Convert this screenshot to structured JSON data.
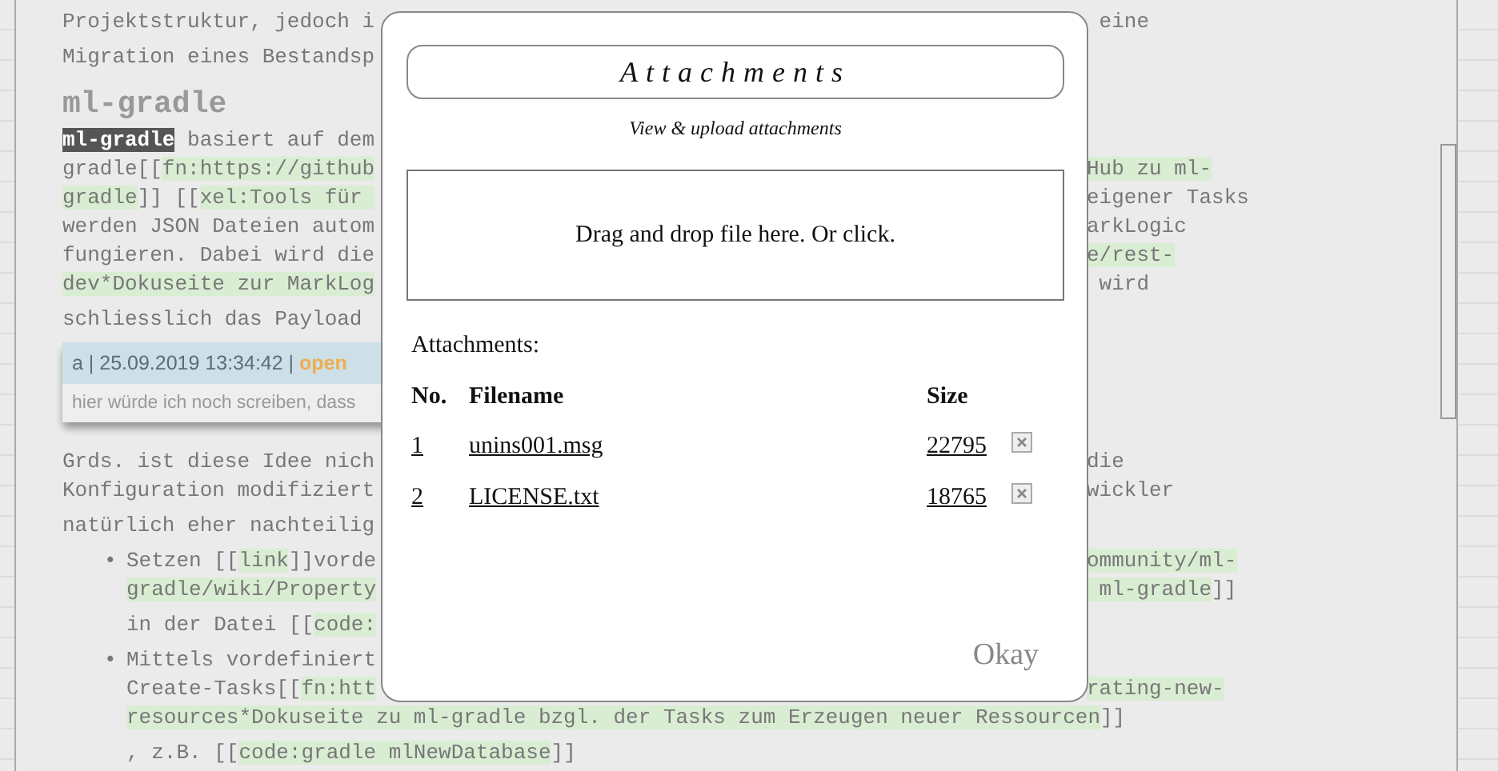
{
  "document": {
    "blocks": [
      {
        "kind": "paragraph",
        "lines": [
          {
            "left": [
              {
                "kind": "plain",
                "text": "Projektstruktur, jedoch i"
              }
            ],
            "right": [
              {
                "kind": "plain",
                "text": " eine"
              }
            ]
          },
          {
            "left": [
              {
                "kind": "plain",
                "text": "Migration eines Bestandsp"
              }
            ]
          }
        ]
      },
      {
        "kind": "heading",
        "text": "ml-gradle"
      },
      {
        "kind": "paragraph",
        "lines": [
          {
            "left": [
              {
                "kind": "dark",
                "text": "ml-gradle"
              },
              {
                "kind": "plain",
                "text": " basiert auf dem"
              }
            ]
          },
          {
            "left": [
              {
                "kind": "plain",
                "text": "gradle[["
              },
              {
                "kind": "green",
                "text": "fn:https://github"
              }
            ],
            "right": [
              {
                "kind": "green",
                "text": "Hub zu ml-"
              }
            ]
          },
          {
            "left": [
              {
                "kind": "green",
                "text": "gradle"
              },
              {
                "kind": "plain",
                "text": "]] [["
              },
              {
                "kind": "green",
                "text": "xel:Tools für "
              }
            ],
            "right": [
              {
                "kind": "plain",
                "text": "eigener Tasks"
              }
            ]
          },
          {
            "left": [
              {
                "kind": "plain",
                "text": "werden JSON Dateien autom"
              }
            ],
            "right": [
              {
                "kind": "plain",
                "text": "arkLogic"
              }
            ]
          },
          {
            "left": [
              {
                "kind": "plain",
                "text": "fungieren. Dabei wird die"
              }
            ],
            "right": [
              {
                "kind": "green",
                "text": "e/rest-"
              }
            ]
          },
          {
            "left": [
              {
                "kind": "green",
                "text": "dev*Dokuseite zur MarkLog"
              }
            ],
            "right": [
              {
                "kind": "plain",
                "text": " wird"
              }
            ]
          },
          {
            "left": [
              {
                "kind": "plain",
                "text": "schliesslich das Payload"
              }
            ]
          }
        ]
      },
      {
        "kind": "comment",
        "header": "a | 25.09.2019 13:34:42 |",
        "status": "open",
        "text": "hier würde ich noch screiben, dass"
      },
      {
        "kind": "paragraph",
        "lines": [
          {
            "left": [
              {
                "kind": "plain",
                "text": "Grds. ist diese Idee nich"
              }
            ],
            "right": [
              {
                "kind": "plain",
                "text": "die"
              }
            ]
          },
          {
            "left": [
              {
                "kind": "plain",
                "text": "Konfiguration modifiziert"
              }
            ],
            "right": [
              {
                "kind": "plain",
                "text": "wickler"
              }
            ]
          },
          {
            "left": [
              {
                "kind": "plain",
                "text": "natürlich eher nachteilig"
              }
            ]
          }
        ]
      },
      {
        "kind": "bullet",
        "marker": "•",
        "lines": [
          {
            "left": [
              {
                "kind": "plain",
                "text": "Setzen [["
              },
              {
                "kind": "green",
                "text": "link"
              },
              {
                "kind": "plain",
                "text": "]]vorde"
              }
            ],
            "right": [
              {
                "kind": "green",
                "text": "ommunity/ml-"
              }
            ]
          },
          {
            "left": [
              {
                "kind": "green",
                "text": "gradle/wiki/Property"
              }
            ],
            "right": [
              {
                "kind": "green",
                "text": " ml-gradle"
              },
              {
                "kind": "plain",
                "text": "]]"
              }
            ]
          },
          {
            "left": [
              {
                "kind": "plain",
                "text": "in der Datei [["
              },
              {
                "kind": "green",
                "text": "code:"
              }
            ]
          }
        ]
      },
      {
        "kind": "bullet",
        "marker": "•",
        "lines": [
          {
            "left": [
              {
                "kind": "plain",
                "text": "Mittels vordefiniert"
              }
            ]
          },
          {
            "left": [
              {
                "kind": "plain",
                "text": "Create-Tasks[["
              },
              {
                "kind": "green",
                "text": "fn:htt"
              }
            ],
            "right": [
              {
                "kind": "green",
                "text": "rating-new-"
              }
            ]
          },
          {
            "left": [
              {
                "kind": "green",
                "text": "resources*Dokuseite zu ml-gradle bzgl. der Tasks zum Erzeugen neuer Ressourcen"
              },
              {
                "kind": "plain",
                "text": "]]"
              }
            ]
          },
          {
            "left": [
              {
                "kind": "plain",
                "text": ", z.B. [["
              },
              {
                "kind": "green",
                "text": "code:gradle mlNewDatabase"
              },
              {
                "kind": "plain",
                "text": "]]"
              }
            ]
          }
        ]
      }
    ]
  },
  "dialog": {
    "title": "Attachments",
    "subtitle": "View & upload attachments",
    "dropzone": "Drag and drop file here. Or click.",
    "list_label": "Attachments:",
    "columns": [
      "No.",
      "Filename",
      "Size"
    ],
    "rows": [
      {
        "no": "1",
        "filename": "unins001.msg",
        "size": "22795"
      },
      {
        "no": "2",
        "filename": "LICENSE.txt",
        "size": "18765"
      }
    ],
    "ok_button": "Okay"
  }
}
